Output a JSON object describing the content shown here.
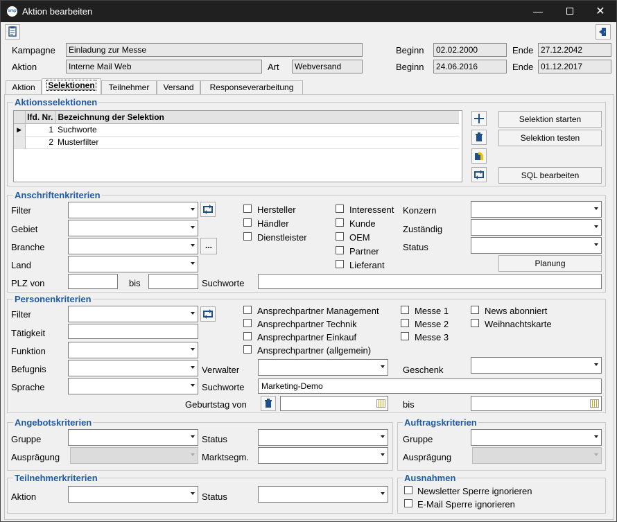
{
  "window": {
    "title": "Aktion bearbeiten",
    "logo_text": "smp"
  },
  "header": {
    "kampagne_label": "Kampagne",
    "kampagne_value": "Einladung zur Messe",
    "aktion_label": "Aktion",
    "aktion_value": "Interne Mail Web",
    "art_label": "Art",
    "art_value": "Webversand",
    "beginn_label": "Beginn",
    "beginn1": "02.02.2000",
    "beginn2": "24.06.2016",
    "ende_label": "Ende",
    "ende1": "27.12.2042",
    "ende2": "01.12.2017"
  },
  "tabs": [
    "Aktion",
    "Selektionen",
    "Teilnehmer",
    "Versand",
    "Responseverarbeitung"
  ],
  "aktionsselektionen": {
    "title": "Aktionsselektionen",
    "col_nr": "lfd. Nr.",
    "col_name": "Bezeichnung der Selektion",
    "rows": [
      {
        "nr": "1",
        "name": "Suchworte"
      },
      {
        "nr": "2",
        "name": "Musterfilter"
      }
    ],
    "btn_start": "Selektion starten",
    "btn_test": "Selektion testen",
    "btn_sql": "SQL bearbeiten"
  },
  "anschrift": {
    "title": "Anschriftenkriterien",
    "filter": "Filter",
    "gebiet": "Gebiet",
    "branche": "Branche",
    "land": "Land",
    "plz_von": "PLZ von",
    "bis": "bis",
    "suchworte": "Suchworte",
    "checks_a": [
      "Hersteller",
      "Händler",
      "Dienstleister"
    ],
    "checks_b": [
      "Interessent",
      "Kunde",
      "OEM",
      "Partner",
      "Lieferant"
    ],
    "konzern": "Konzern",
    "zustaendig": "Zuständig",
    "status": "Status",
    "btn_planung": "Planung",
    "ellipsis": "..."
  },
  "person": {
    "title": "Personenkriterien",
    "filter": "Filter",
    "taetigkeit": "Tätigkeit",
    "funktion": "Funktion",
    "befugnis": "Befugnis",
    "sprache": "Sprache",
    "checks_a": [
      "Ansprechpartner Management",
      "Ansprechpartner Technik",
      "Ansprechpartner Einkauf",
      "Ansprechpartner (allgemein)"
    ],
    "checks_b": [
      "Messe 1",
      "Messe 2",
      "Messe 3"
    ],
    "checks_c": [
      "News abonniert",
      "Weihnachtskarte"
    ],
    "verwalter": "Verwalter",
    "geschenk": "Geschenk",
    "suchworte": "Suchworte",
    "suchworte_value": "Marketing-Demo",
    "geburtstag_von": "Geburtstag von",
    "bis": "bis"
  },
  "angebot": {
    "title": "Angebotskriterien",
    "gruppe": "Gruppe",
    "auspraegung": "Ausprägung",
    "status": "Status",
    "marktsegm": "Marktsegm."
  },
  "auftrag": {
    "title": "Auftragskriterien",
    "gruppe": "Gruppe",
    "auspraegung": "Ausprägung"
  },
  "teilnehmer": {
    "title": "Teilnehmerkriterien",
    "aktion": "Aktion",
    "status": "Status"
  },
  "ausnahmen": {
    "title": "Ausnahmen",
    "checks": [
      "Newsletter Sperre ignorieren",
      "E-Mail Sperre ignorieren"
    ]
  },
  "colors": {
    "accent": "#1f5aa6",
    "titlebar": "#202020"
  }
}
